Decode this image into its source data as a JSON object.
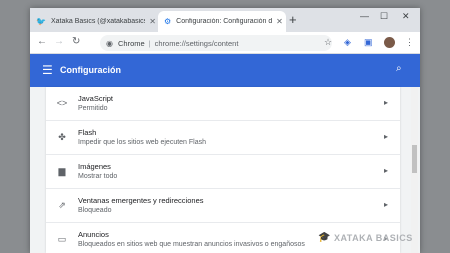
{
  "tabs": [
    {
      "title": "Xataka Basics (@xatakabasics) / Twitter",
      "icon": "twitter-icon"
    },
    {
      "title": "Configuración: Configuración del sitio",
      "icon": "settings-gear-icon"
    }
  ],
  "omnibox": {
    "scheme_label": "Chrome",
    "url": "chrome://settings/content"
  },
  "settings": {
    "title": "Configuración"
  },
  "rows": [
    {
      "title": "JavaScript",
      "subtitle": "Permitido",
      "icon": "code-brackets-icon"
    },
    {
      "title": "Flash",
      "subtitle": "Impedir que los sitios web ejecuten Flash",
      "icon": "puzzle-icon"
    },
    {
      "title": "Imágenes",
      "subtitle": "Mostrar todo",
      "icon": "image-icon"
    },
    {
      "title": "Ventanas emergentes y redirecciones",
      "subtitle": "Bloqueado",
      "icon": "popup-icon"
    },
    {
      "title": "Anuncios",
      "subtitle": "Bloqueados en sitios web que muestran anuncios invasivos o engañosos",
      "icon": "ad-icon"
    }
  ],
  "watermark": "XATAKA BASICS",
  "colors": {
    "header": "#3367d6",
    "twitter": "#1da1f2"
  }
}
